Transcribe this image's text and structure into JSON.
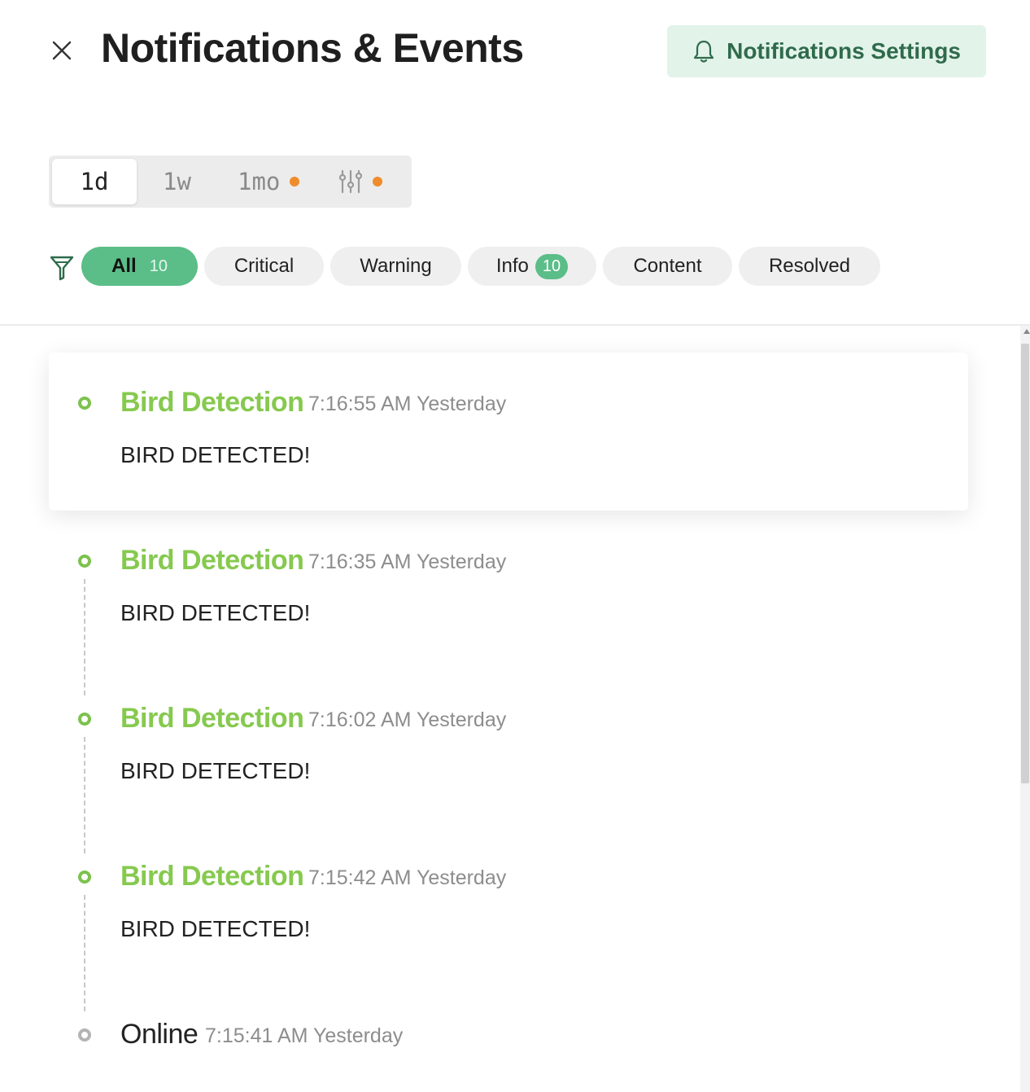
{
  "header": {
    "title": "Notifications & Events",
    "settings_label": "Notifications Settings"
  },
  "range": {
    "tabs": [
      {
        "label": "1d",
        "active": true
      },
      {
        "label": "1w",
        "active": false
      },
      {
        "label": "1mo",
        "active": false,
        "dot": true
      }
    ],
    "custom_icon": "sliders-icon",
    "custom_dot": true
  },
  "filters": {
    "icon": "filter-icon",
    "chips": [
      {
        "label": "All",
        "count": "10",
        "active": true
      },
      {
        "label": "Critical"
      },
      {
        "label": "Warning"
      },
      {
        "label": "Info",
        "count": "10"
      },
      {
        "label": "Content"
      },
      {
        "label": "Resolved"
      }
    ]
  },
  "events": [
    {
      "title": "Bird Detection",
      "time": "7:16:55 AM Yesterday",
      "message": "BIRD DETECTED!"
    },
    {
      "title": "Bird Detection",
      "time": "7:16:35 AM Yesterday",
      "message": "BIRD DETECTED!"
    },
    {
      "title": "Bird Detection",
      "time": "7:16:02 AM Yesterday",
      "message": "BIRD DETECTED!"
    },
    {
      "title": "Bird Detection",
      "time": "7:15:42 AM Yesterday",
      "message": "BIRD DETECTED!"
    },
    {
      "title": "Online",
      "time": "7:15:41 AM Yesterday"
    }
  ],
  "colors": {
    "accent_green": "#5bbd88",
    "event_green": "#86c94f",
    "settings_bg": "#e2f3ea",
    "settings_text": "#2f6b4b",
    "dot_orange": "#ef8c2b"
  }
}
